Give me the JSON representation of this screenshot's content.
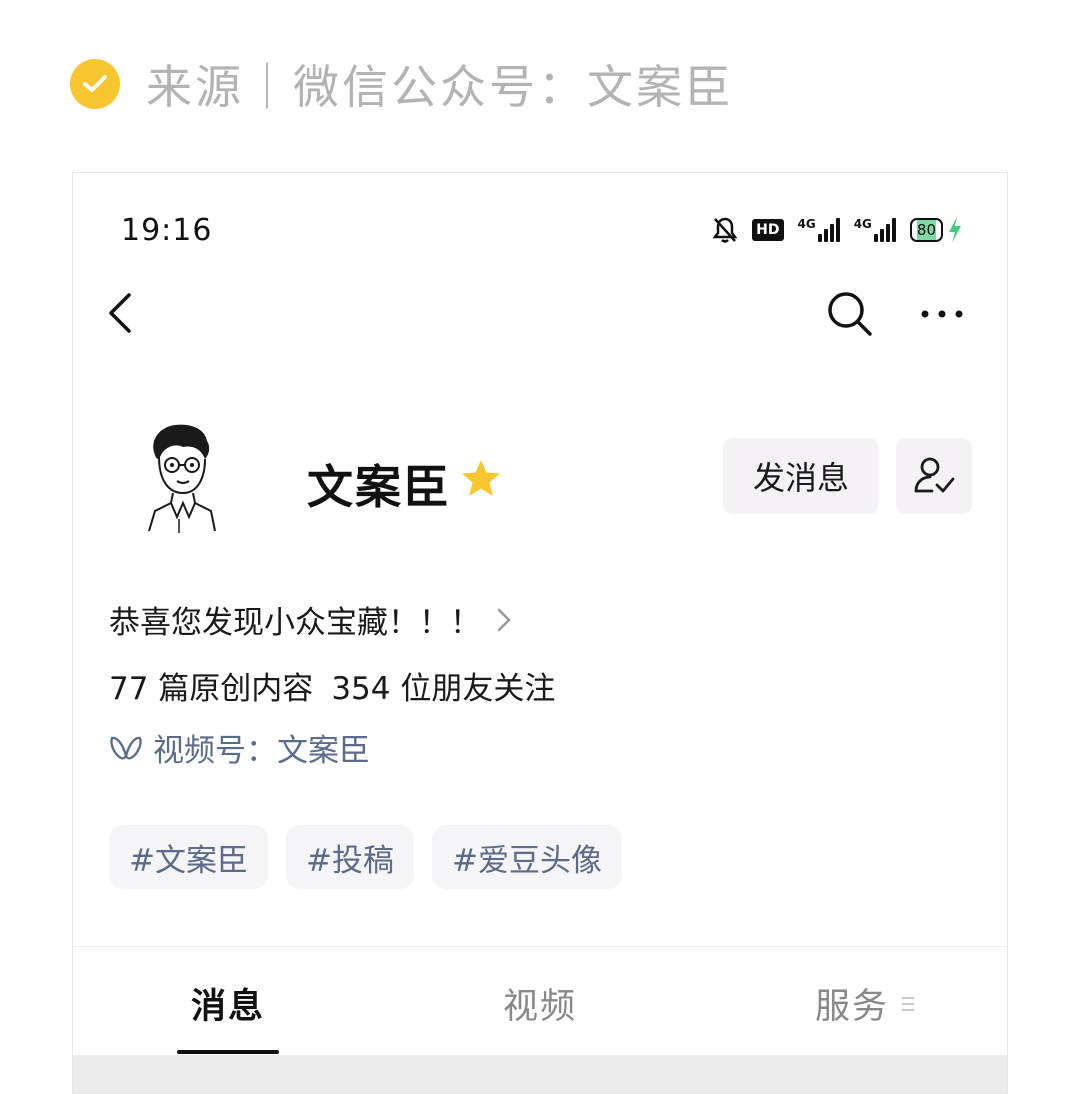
{
  "header": {
    "source_text": "来源｜微信公众号：文案臣",
    "check_icon": "check-circle-icon",
    "accent_color": "#f7c52e"
  },
  "status_bar": {
    "time": "19:16",
    "hd_label": "HD",
    "net1_label": "4G",
    "net2_label": "4G",
    "battery": "80"
  },
  "profile": {
    "name": "文案臣",
    "message_button": "发消息",
    "intro": "恭喜您发现小众宝藏！！！",
    "original_count": "77 篇原创内容",
    "follower_count": "354 位朋友关注",
    "channel": "视频号：文案臣",
    "tags": [
      "#文案臣",
      "#投稿",
      "#爱豆头像"
    ]
  },
  "tabs": [
    {
      "label": "消息",
      "active": true
    },
    {
      "label": "视频",
      "active": false
    },
    {
      "label": "服务",
      "active": false
    }
  ],
  "colors": {
    "link_blue": "#5a6b8c",
    "battery_green": "#3fcf7f"
  }
}
